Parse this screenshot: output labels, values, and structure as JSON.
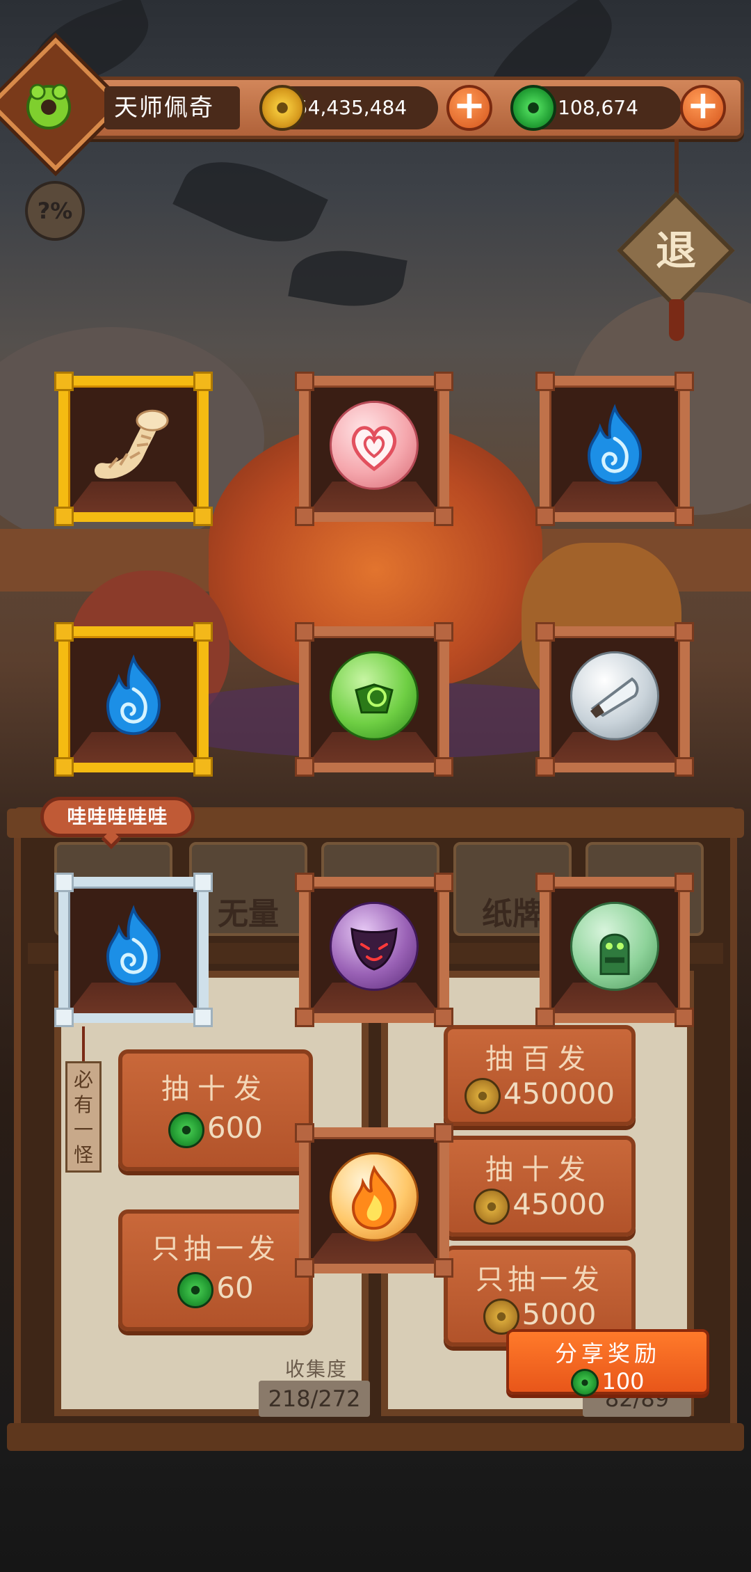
{
  "header": {
    "player_name": "天师佩奇",
    "gold_amount": "54,435,484",
    "jade_amount": "108,674",
    "add_gold_label": "+",
    "add_jade_label": "+"
  },
  "odds_button": {
    "label": "?%"
  },
  "exit_button": {
    "label": "退"
  },
  "reward_slots": [
    {
      "item": "bandaged-bone",
      "frame": "gold"
    },
    {
      "item": "heart-candy-orb",
      "frame": "wood"
    },
    {
      "item": "blue-flame",
      "frame": "wood"
    },
    {
      "item": "blue-flame",
      "frame": "gold"
    },
    {
      "item": "green-jade-orb",
      "frame": "wood"
    },
    {
      "item": "silver-blade-orb",
      "frame": "wood"
    },
    {
      "item": "blue-flame",
      "frame": "silver"
    },
    {
      "item": "purple-mask-orb",
      "frame": "wood"
    },
    {
      "item": "jade-idol-orb",
      "frame": "wood"
    },
    {
      "item": "fire-orb",
      "frame": "wood"
    }
  ],
  "speech_bubble": {
    "text": "哇哇哇哇哇"
  },
  "category_tabs": [
    {
      "label": ""
    },
    {
      "label": "无量"
    },
    {
      "label": ""
    },
    {
      "label": "纸牌"
    },
    {
      "label": ""
    }
  ],
  "jade_draws": {
    "tag": "必有一怪",
    "ten": {
      "label": "抽十发",
      "price": "600"
    },
    "one": {
      "label": "只抽一发",
      "price": "60"
    }
  },
  "gold_draws": {
    "hundred": {
      "label": "抽百发",
      "price": "450000"
    },
    "ten": {
      "label": "抽十发",
      "price": "45000"
    },
    "one": {
      "label": "只抽一发",
      "price": "5000"
    }
  },
  "collection": {
    "label": "收集度",
    "left_count": "218/272",
    "right_count": "82/89"
  },
  "share": {
    "label": "分享奖励",
    "amount": "100"
  },
  "colors": {
    "gold_frame": "#f5bb12",
    "wood_frame": "#c0724a",
    "silver_frame": "#cfe0ea",
    "button_orange": "#b2532a",
    "share_orange": "#ff7a2a"
  }
}
